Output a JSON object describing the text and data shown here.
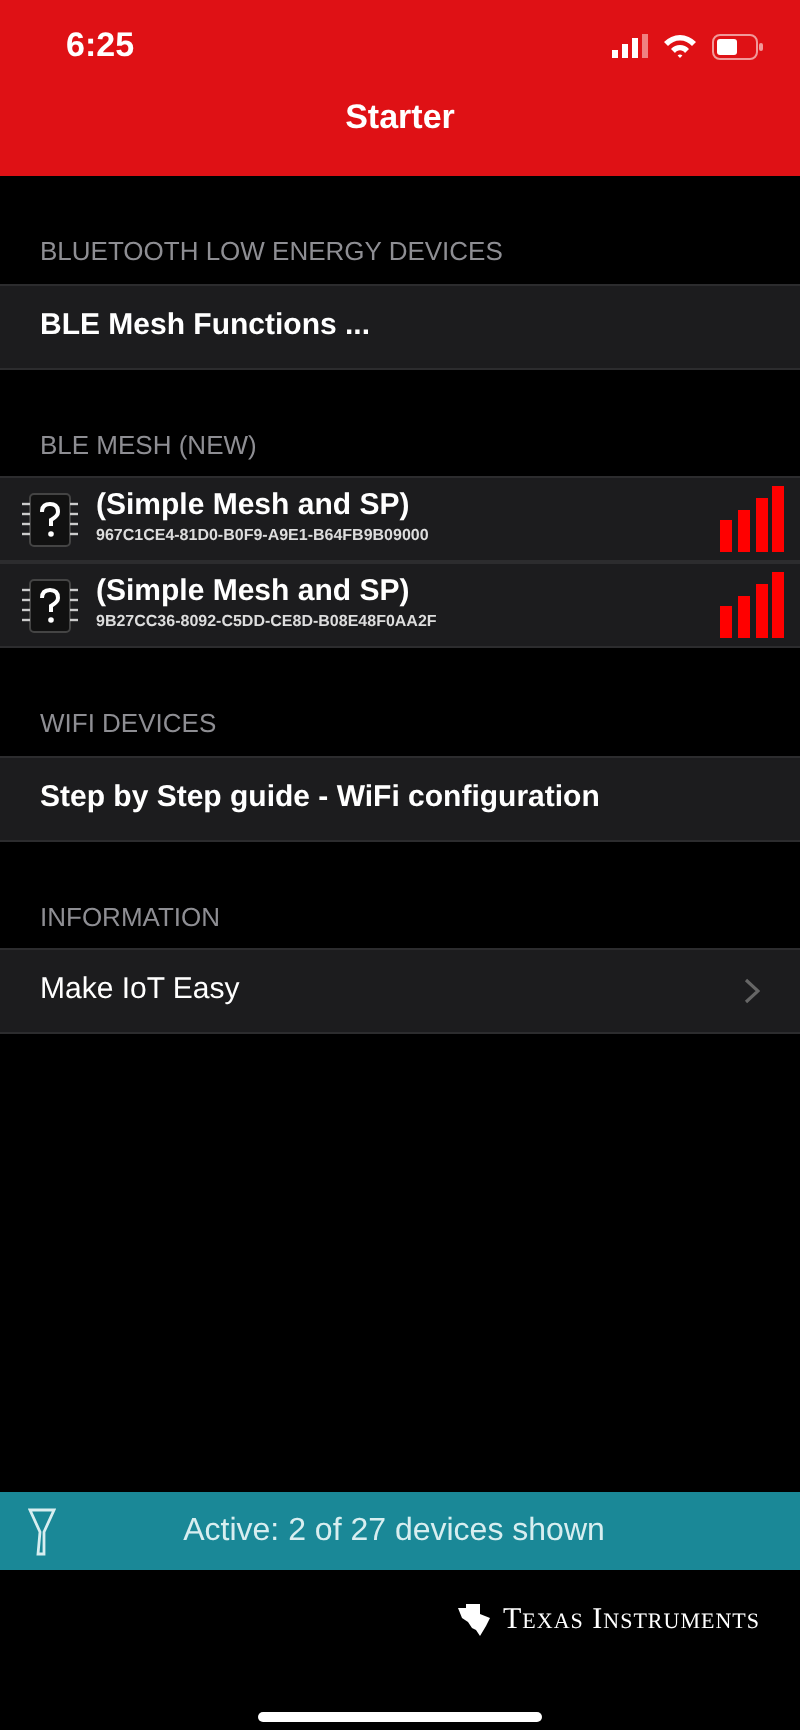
{
  "status_bar": {
    "time": "6:25"
  },
  "nav": {
    "title": "Starter"
  },
  "sections": [
    {
      "header": "BLUETOOTH LOW ENERGY DEVICES",
      "rows": [
        {
          "kind": "action",
          "title": "BLE Mesh Functions ..."
        }
      ]
    },
    {
      "header": "BLE MESH (NEW)",
      "rows": [
        {
          "kind": "device",
          "title": "(Simple Mesh and SP)",
          "subtitle": "967C1CE4-81D0-B0F9-A9E1-B64FB9B09000"
        },
        {
          "kind": "device",
          "title": "(Simple Mesh and SP)",
          "subtitle": "9B27CC36-8092-C5DD-CE8D-B08E48F0AA2F"
        }
      ]
    },
    {
      "header": "WIFI DEVICES",
      "rows": [
        {
          "kind": "action",
          "title": "Step by Step guide - WiFi configuration"
        }
      ]
    },
    {
      "header": "INFORMATION",
      "rows": [
        {
          "kind": "link",
          "title": "Make IoT Easy"
        }
      ]
    }
  ],
  "filter_bar": {
    "text": "Active: 2 of 27 devices shown"
  },
  "footer": {
    "brand": "Texas Instruments"
  }
}
